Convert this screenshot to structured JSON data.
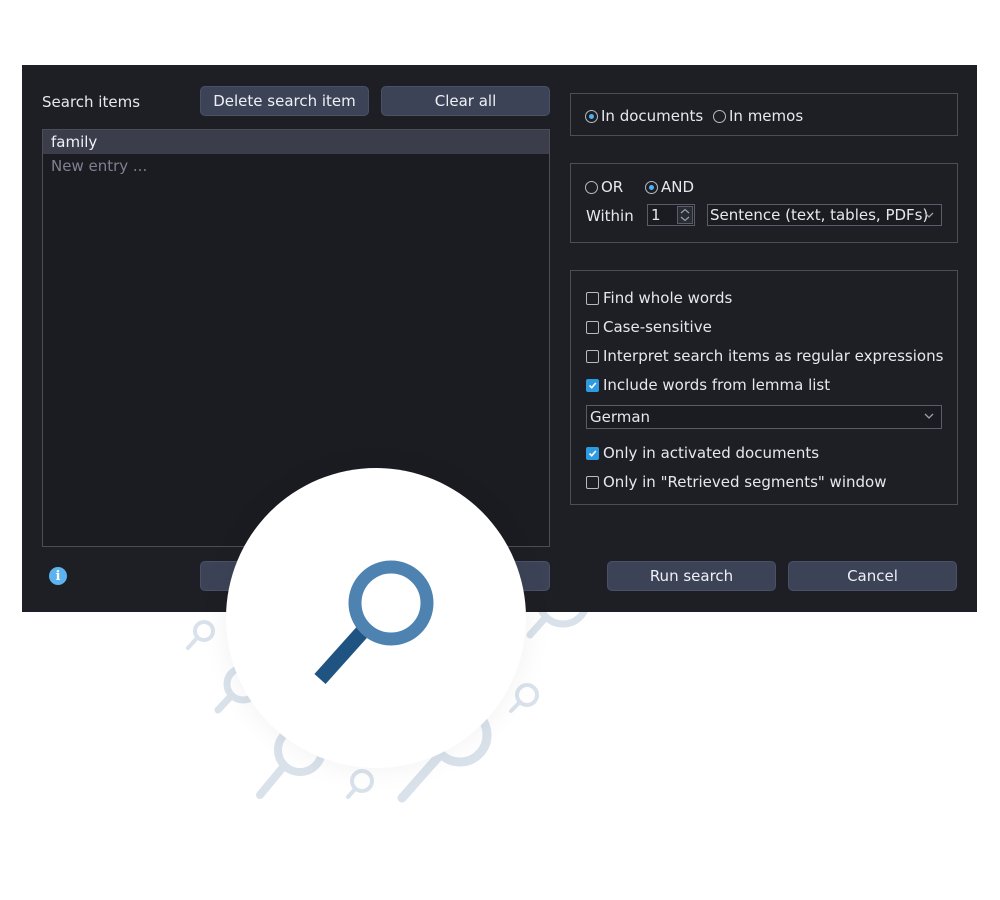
{
  "left_panel": {
    "title": "Search items",
    "delete_label": "Delete search item",
    "clear_label": "Clear all",
    "items": [
      "family"
    ],
    "new_entry_placeholder": "New entry ..."
  },
  "scope": {
    "in_documents": "In documents",
    "in_memos": "In memos",
    "selected": "In documents"
  },
  "logic": {
    "or_label": "OR",
    "and_label": "AND",
    "selected": "AND",
    "within_label": "Within",
    "within_value": "1",
    "unit_value": "Sentence (text, tables, PDFs)"
  },
  "options": {
    "whole_words": "Find whole words",
    "case_sensitive": "Case-sensitive",
    "regex": "Interpret search items as regular expressions",
    "lemma": "Include words from lemma list",
    "language": "German",
    "activated_docs": "Only in activated documents",
    "retrieved_segments": "Only in \"Retrieved segments\" window",
    "checked": [
      "lemma",
      "activated_docs"
    ]
  },
  "footer": {
    "run_label": "Run search",
    "cancel_label": "Cancel"
  },
  "colors": {
    "dialog_bg": "#1e1f25",
    "button_bg": "#3d4357",
    "accent": "#2e9be0",
    "magnifier": "#1f5482"
  },
  "icons": [
    "info-icon",
    "magnifier-icon",
    "chevron-down-icon",
    "checkmark-icon"
  ]
}
